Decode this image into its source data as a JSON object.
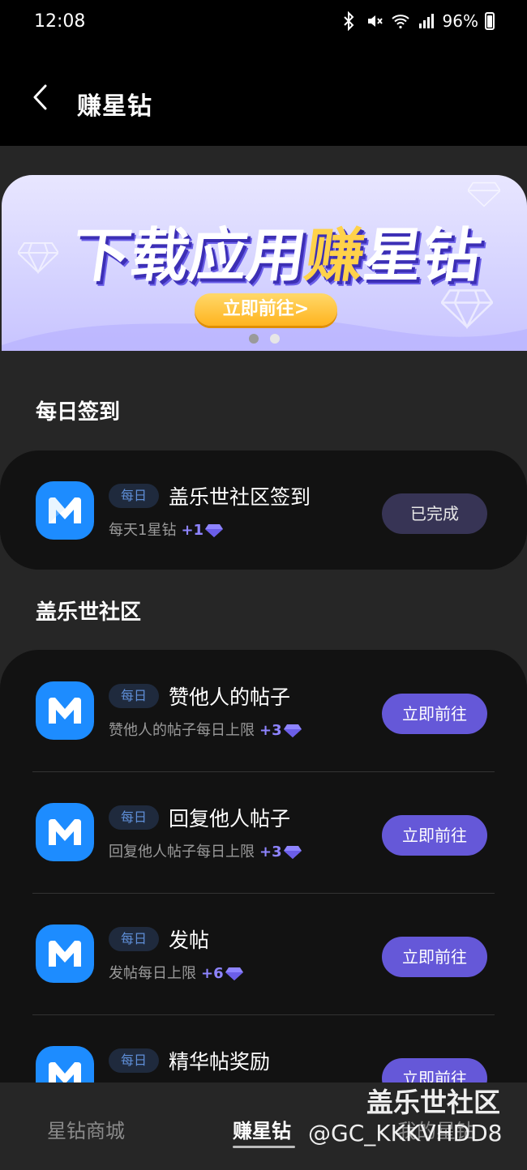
{
  "status_bar": {
    "time": "12:08",
    "battery": "96%"
  },
  "header": {
    "title": "赚星钻"
  },
  "banner": {
    "title_part1": "下载应用",
    "title_part2": "赚",
    "title_part3": "星钻",
    "button_label": "立即前往>"
  },
  "sections": {
    "daily_title": "每日签到",
    "community_title": "盖乐世社区"
  },
  "daily_task": {
    "tag": "每日",
    "name": "盖乐世社区签到",
    "desc": "每天1星钻",
    "reward": "+1",
    "button": "已完成"
  },
  "community_tasks": [
    {
      "tag": "每日",
      "name": "赞他人的帖子",
      "desc": "赞他人的帖子每日上限",
      "reward": "+3",
      "button": "立即前往"
    },
    {
      "tag": "每日",
      "name": "回复他人帖子",
      "desc": "回复他人帖子每日上限",
      "reward": "+3",
      "button": "立即前往"
    },
    {
      "tag": "每日",
      "name": "发帖",
      "desc": "发帖每日上限",
      "reward": "+6",
      "button": "立即前往"
    },
    {
      "tag": "每日",
      "name": "精华帖奖励",
      "desc": "",
      "reward": "",
      "button": "立即前往"
    }
  ],
  "bottom_nav": {
    "items": [
      "星钻商城",
      "赚星钻",
      "我的星钻"
    ],
    "active": "赚星钻"
  },
  "watermark": {
    "line1": "盖乐世社区",
    "line2": "@GC_KKKVHDD8"
  },
  "colors": {
    "accent": "#6558d8",
    "app_icon": "#1d8cff",
    "reward": "#8e84ff"
  }
}
